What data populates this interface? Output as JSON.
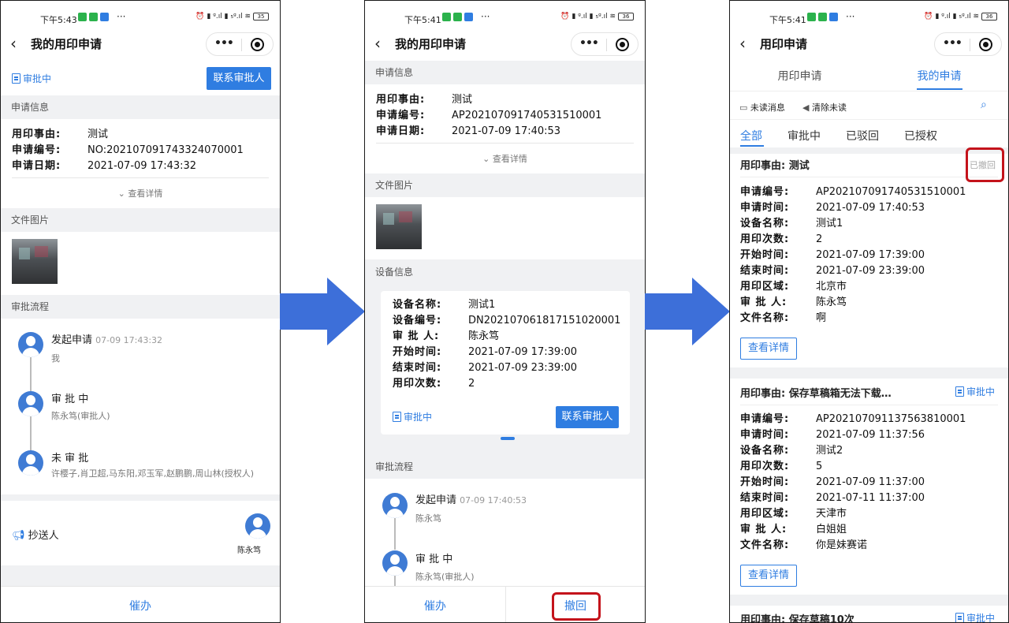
{
  "status_bar": [
    {
      "time": "下午5:43",
      "battery": "35"
    },
    {
      "time": "下午5:41",
      "battery": "36"
    },
    {
      "time": "下午5:41",
      "battery": "36"
    }
  ],
  "screen1": {
    "title": "我的用印申请",
    "status_label": "审批中",
    "contact_button": "联系审批人",
    "section_info": "申请信息",
    "reason_label": "用印事由:",
    "reason_value": "测试",
    "number_label": "申请编号:",
    "number_value": "NO:202107091743324070001",
    "date_label": "申请日期:",
    "date_value": "2021-07-09 17:43:32",
    "view_details": "查看详情",
    "section_images": "文件图片",
    "section_flow": "审批流程",
    "flow": [
      {
        "title": "发起申请",
        "time": "07-09 17:43:32",
        "sub": "我"
      },
      {
        "title": "审 批 中",
        "time": "",
        "sub": "陈永笃(审批人)"
      },
      {
        "title": "未 审 批",
        "time": "",
        "sub": "许樱子,肖卫超,马东阳,邓玉军,赵鹏鹏,周山林(授权人)"
      }
    ],
    "cc_label": "抄送人",
    "cc_name": "陈永笃",
    "urge_button": "催办"
  },
  "screen2": {
    "title": "我的用印申请",
    "section_info": "申请信息",
    "reason_label": "用印事由:",
    "reason_value": "测试",
    "number_label": "申请编号:",
    "number_value": "AP202107091740531510001",
    "date_label": "申请日期:",
    "date_value": "2021-07-09 17:40:53",
    "view_details": "查看详情",
    "section_images": "文件图片",
    "section_device": "设备信息",
    "device": {
      "name_label": "设备名称:",
      "name_value": "测试1",
      "id_label": "设备编号:",
      "id_value": "DN202107061817151020001",
      "approver_label": "审 批 人:",
      "approver_value": "陈永笃",
      "start_label": "开始时间:",
      "start_value": "2021-07-09 17:39:00",
      "end_label": "结束时间:",
      "end_value": "2021-07-09 23:39:00",
      "count_label": "用印次数:",
      "count_value": "2"
    },
    "status_label": "审批中",
    "contact_button": "联系审批人",
    "section_flow": "审批流程",
    "flow": [
      {
        "title": "发起申请",
        "time": "07-09 17:40:53",
        "sub": "陈永笃"
      },
      {
        "title": "审 批 中",
        "time": "",
        "sub": "陈永笃(审批人)"
      }
    ],
    "urge_button": "催办",
    "withdraw_button": "撤回"
  },
  "screen3": {
    "title": "用印申请",
    "tabs": [
      "用印申请",
      "我的申请"
    ],
    "unread_label": "未读消息",
    "clear_label": "清除未读",
    "filters": [
      "全部",
      "审批中",
      "已驳回",
      "已授权"
    ],
    "cards": [
      {
        "reason": "用印事由: 测试",
        "badge": "已撤回",
        "fields": [
          [
            "申请编号:",
            "AP202107091740531510001"
          ],
          [
            "申请时间:",
            "2021-07-09 17:40:53"
          ],
          [
            "设备名称:",
            "测试1"
          ],
          [
            "用印次数:",
            "2"
          ],
          [
            "开始时间:",
            "2021-07-09 17:39:00"
          ],
          [
            "结束时间:",
            "2021-07-09 23:39:00"
          ],
          [
            "用印区域:",
            "北京市"
          ],
          [
            "审 批 人:",
            "陈永笃"
          ],
          [
            "文件名称:",
            "啊"
          ]
        ],
        "details": "查看详情"
      },
      {
        "reason": "用印事由: 保存草稿箱无法下载…",
        "badge": "审批中",
        "fields": [
          [
            "申请编号:",
            "AP202107091137563810001"
          ],
          [
            "申请时间:",
            "2021-07-09 11:37:56"
          ],
          [
            "设备名称:",
            "测试2"
          ],
          [
            "用印次数:",
            "5"
          ],
          [
            "开始时间:",
            "2021-07-09 11:37:00"
          ],
          [
            "结束时间:",
            "2021-07-11 11:37:00"
          ],
          [
            "用印区域:",
            "天津市"
          ],
          [
            "审 批 人:",
            "白姐姐"
          ],
          [
            "文件名称:",
            "你是妹赛诺"
          ]
        ],
        "details": "查看详情"
      },
      {
        "reason": "用印事由: 保存草稿10次",
        "badge": "审批中"
      }
    ]
  },
  "colors": {
    "accent": "#2f7de1",
    "highlight": "#c4131b",
    "arrow": "#3d6fd9"
  }
}
